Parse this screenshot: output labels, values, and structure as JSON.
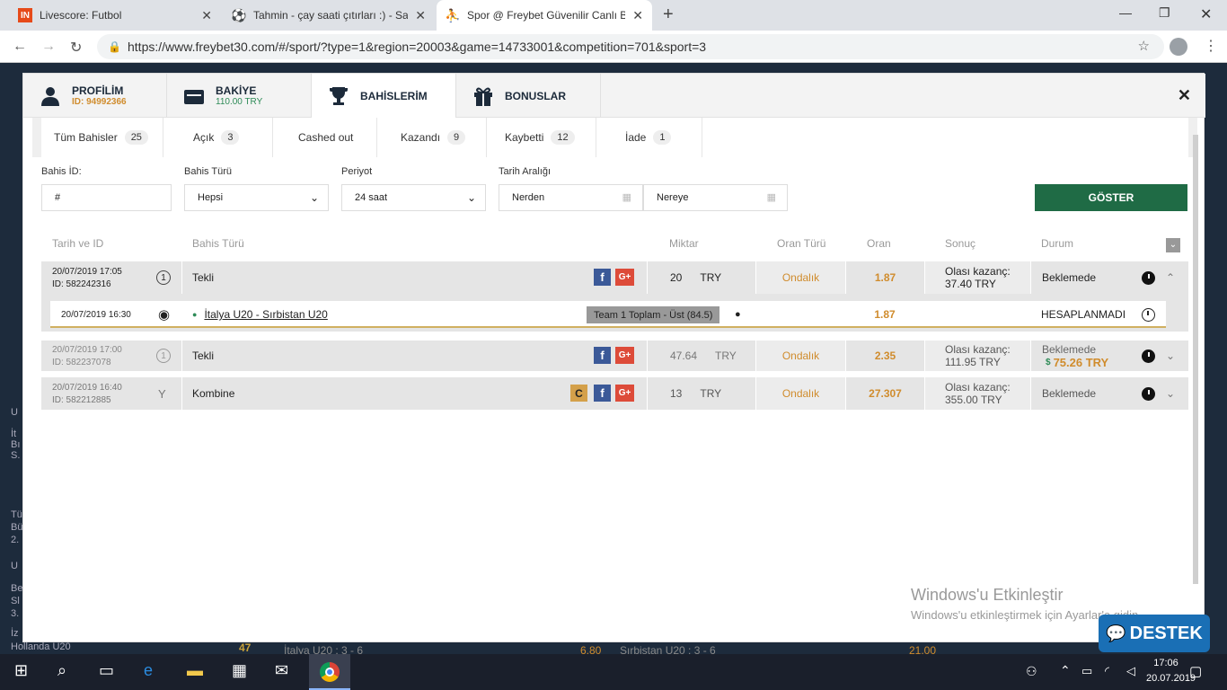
{
  "browser": {
    "tabs": [
      {
        "icon": "livescore-icon",
        "title": "Livescore: Futbol"
      },
      {
        "icon": "soccer-ball-icon",
        "title": "Tahmin - çay saati çıtırları :) - Say"
      },
      {
        "icon": "freybet-icon",
        "title": "Spor @ Freybet Güvenilir Canlı B"
      }
    ],
    "url": "https://www.freybet30.com/#/sport/?type=1&region=20003&game=14733001&competition=701&sport=3"
  },
  "modal": {
    "tabs": [
      {
        "title": "PROFİLİM",
        "sub": "ID: 94992366"
      },
      {
        "title": "BAKİYE",
        "sub": "110.00 TRY"
      },
      {
        "title": "BAHİSLERİM",
        "sub": ""
      },
      {
        "title": "BONUSLAR",
        "sub": ""
      }
    ],
    "filters": [
      {
        "label": "Tüm Bahisler",
        "count": "25"
      },
      {
        "label": "Açık",
        "count": "3"
      },
      {
        "label": "Cashed out",
        "count": ""
      },
      {
        "label": "Kazandı",
        "count": "9"
      },
      {
        "label": "Kaybetti",
        "count": "12"
      },
      {
        "label": "İade",
        "count": "1"
      }
    ],
    "form": {
      "bet_id_label": "Bahis İD:",
      "bet_id_value": "#",
      "bet_type_label": "Bahis Türü",
      "bet_type_value": "Hepsi",
      "period_label": "Periyot",
      "period_value": "24 saat",
      "date_range_label": "Tarih Aralığı",
      "from_value": "Nerden",
      "to_value": "Nereye",
      "show_button": "GÖSTER"
    },
    "table": {
      "headers": [
        "Tarih ve ID",
        "Bahis Türü",
        "Miktar",
        "Oran Türü",
        "Oran",
        "Sonuç",
        "Durum"
      ],
      "rows": [
        {
          "date": "20/07/2019 17:05",
          "id": "ID: 582242316",
          "type_icon": "1",
          "type": "Tekli",
          "amount": "20",
          "currency": "TRY",
          "odds_type": "Ondalık",
          "odds": "1.87",
          "result_label": "Olası kazanç:",
          "result_value": "37.40 TRY",
          "status": "Beklemede",
          "extra": ""
        },
        {
          "date": "20/07/2019 17:00",
          "id": "ID: 582237078",
          "type_icon": "1",
          "type": "Tekli",
          "amount": "47.64",
          "currency": "TRY",
          "odds_type": "Ondalık",
          "odds": "2.35",
          "result_label": "Olası kazanç:",
          "result_value": "111.95 TRY",
          "status": "Beklemede",
          "extra": "75.26 TRY"
        },
        {
          "date": "20/07/2019 16:40",
          "id": "ID: 582212885",
          "type_icon": "Y",
          "type": "Kombine",
          "amount": "13",
          "currency": "TRY",
          "odds_type": "Ondalık",
          "odds": "27.307",
          "result_label": "Olası kazanç:",
          "result_value": "355.00 TRY",
          "status": "Beklemede",
          "extra": ""
        }
      ],
      "detail": {
        "date": "20/07/2019 16:30",
        "match": "İtalya U20 - Sırbistan U20",
        "market": "Team 1 Toplam - Üst (84.5)",
        "odds": "1.87",
        "status": "HESAPLANMADI"
      }
    }
  },
  "background": {
    "side_texts": [
      "U",
      "İt",
      "Bı",
      "S.",
      "Tü",
      "Bü",
      "2.",
      "U",
      "Be",
      "Sl",
      "3.",
      "İz",
      "Hollanda U20"
    ],
    "bottom_left_value": "47",
    "bottom_mid": "İtalya U20 : 3 - 6",
    "bottom_odd1": "6.80",
    "bottom_right": "Sırbistan U20 : 3 - 6",
    "bottom_odd2": "21.00"
  },
  "watermark": {
    "title": "Windows'u Etkinleştir",
    "sub": "Windows'u etkinleştirmek için Ayarlar'a gidin."
  },
  "destek": "DESTEK",
  "taskbar": {
    "time": "17:06",
    "date": "20.07.2019"
  },
  "colors": {
    "accent_green": "#1f6b45",
    "orange": "#d08c2d",
    "facebook": "#3b5998",
    "gplus": "#dd4b39"
  }
}
